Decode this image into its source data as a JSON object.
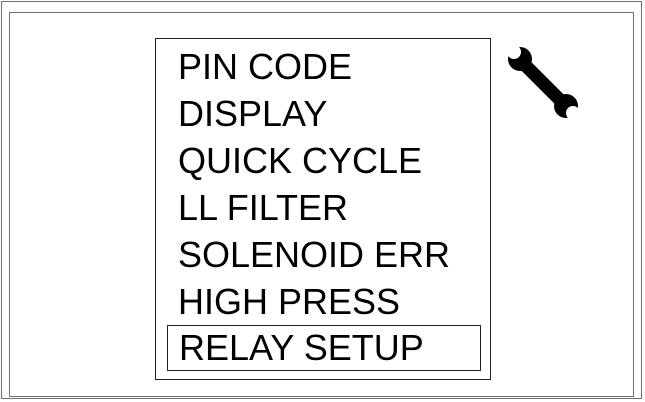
{
  "menu": {
    "items": [
      {
        "label": "PIN CODE"
      },
      {
        "label": "DISPLAY"
      },
      {
        "label": "QUICK CYCLE"
      },
      {
        "label": "LL FILTER"
      },
      {
        "label": "SOLENOID ERR"
      },
      {
        "label": "HIGH PRESS"
      },
      {
        "label": "RELAY SETUP"
      }
    ],
    "selected_label": "RELAY SETUP"
  },
  "icons": {
    "tool": "wrench-icon"
  },
  "colors": {
    "text": "#000000",
    "frame": "#707070",
    "background": "#ffffff"
  }
}
